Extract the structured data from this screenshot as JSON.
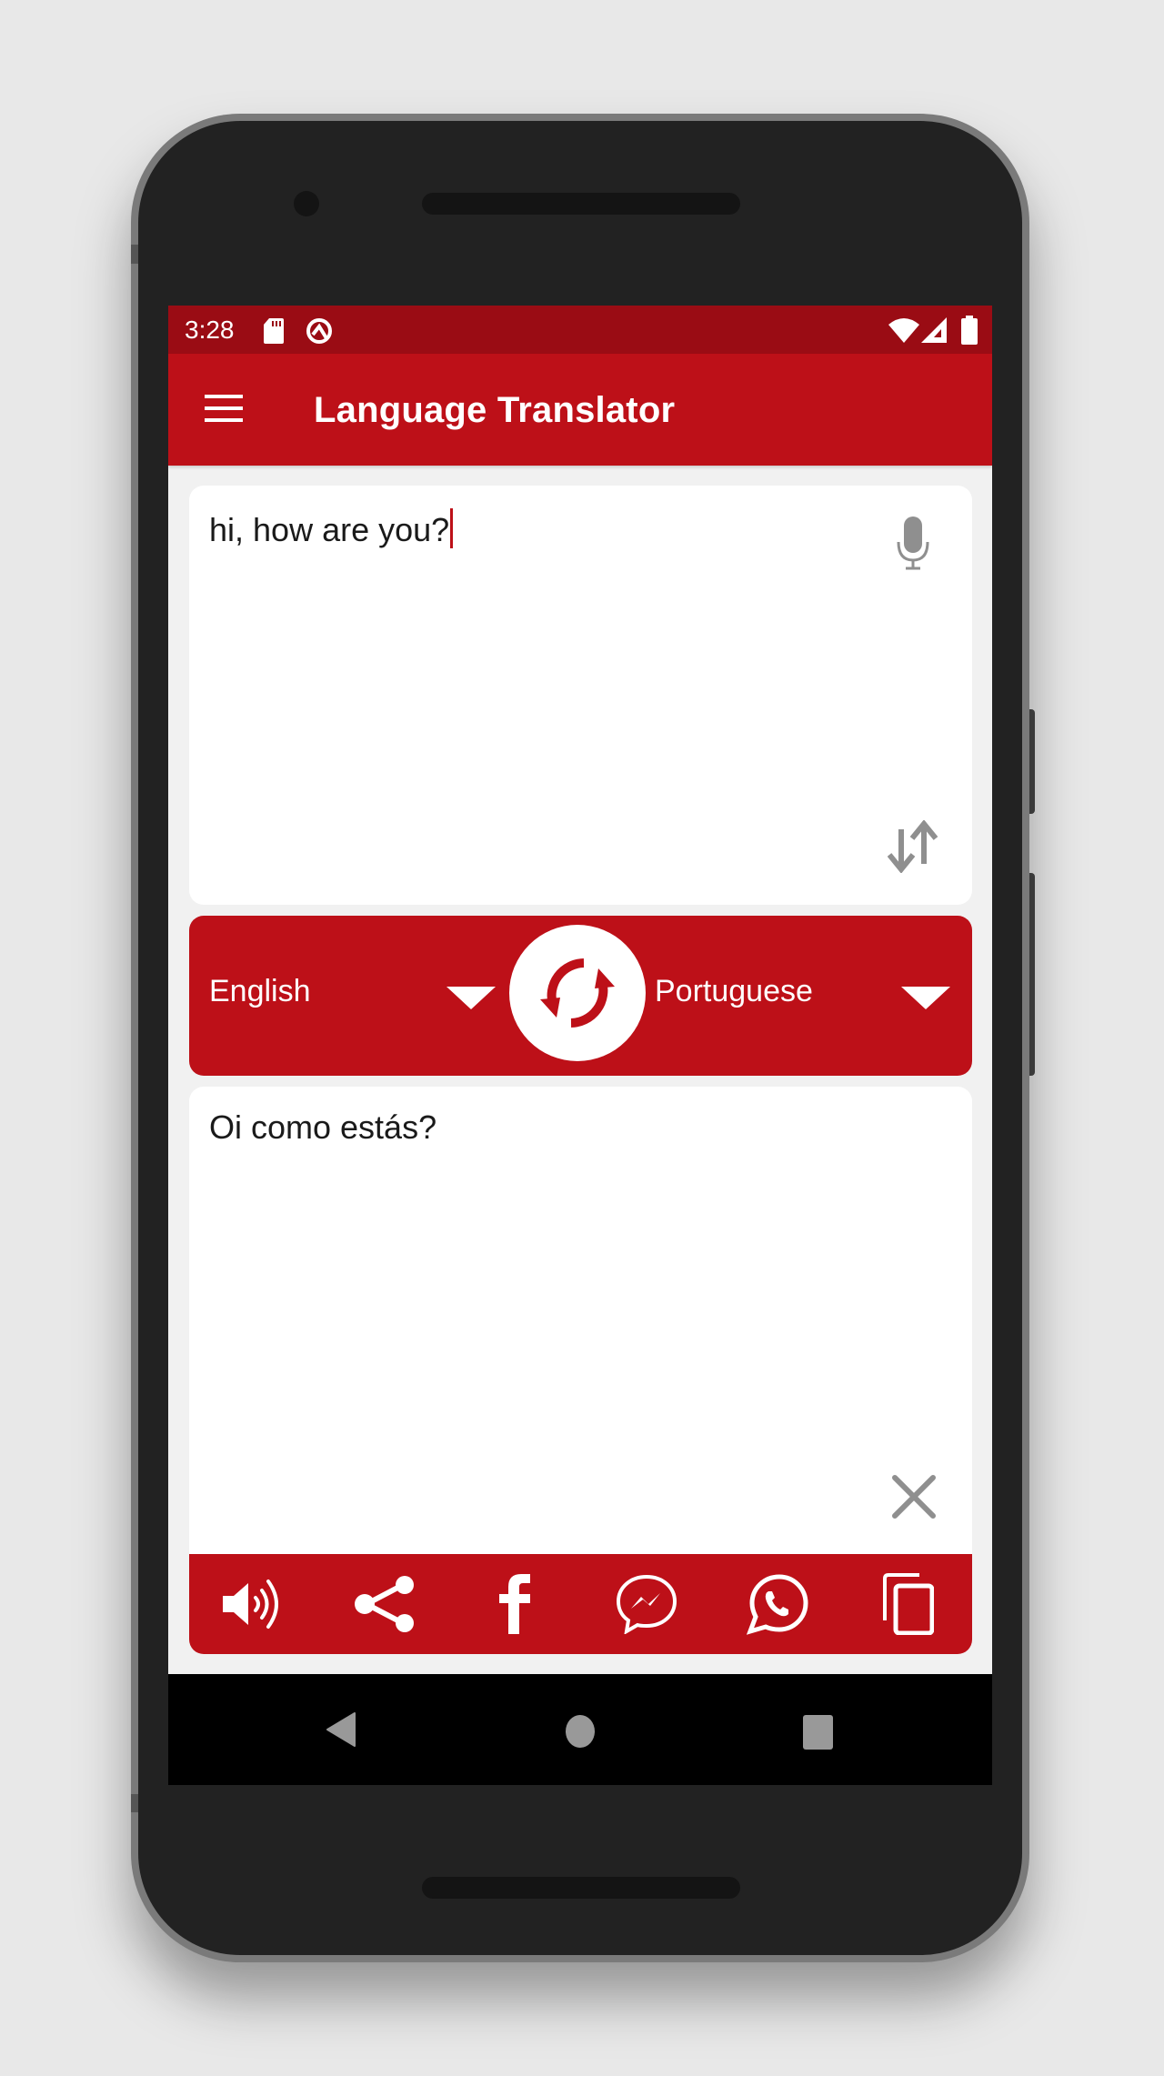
{
  "status_bar": {
    "time": "3:28",
    "left_icons": [
      "sd-card-icon",
      "q-icon"
    ],
    "right_icons": [
      "wifi-icon",
      "signal-icon",
      "battery-icon"
    ]
  },
  "toolbar": {
    "menu_icon": "hamburger-menu-icon",
    "title": "Language Translator"
  },
  "input": {
    "text": "hi, how are you?",
    "mic_icon": "microphone-icon",
    "swap_icon": "swap-vertical-arrows-icon"
  },
  "language_bar": {
    "source_language": "English",
    "target_language": "Portuguese",
    "swap_button_icon": "swap-languages-refresh-icon"
  },
  "output": {
    "text": "Oi como estás?",
    "clear_icon": "close-icon"
  },
  "actions": [
    {
      "name": "speak",
      "icon": "speaker-icon"
    },
    {
      "name": "share",
      "icon": "share-icon"
    },
    {
      "name": "facebook",
      "icon": "facebook-icon"
    },
    {
      "name": "messenger",
      "icon": "messenger-icon"
    },
    {
      "name": "whatsapp",
      "icon": "whatsapp-icon"
    },
    {
      "name": "copy",
      "icon": "copy-icon"
    }
  ],
  "nav_bar": {
    "buttons": [
      "back",
      "home",
      "recents"
    ]
  },
  "colors": {
    "primary": "#bd1018",
    "primary_dark": "#9a0c14",
    "icon_gray": "#8f8f8f",
    "background": "#f1f1f1"
  }
}
